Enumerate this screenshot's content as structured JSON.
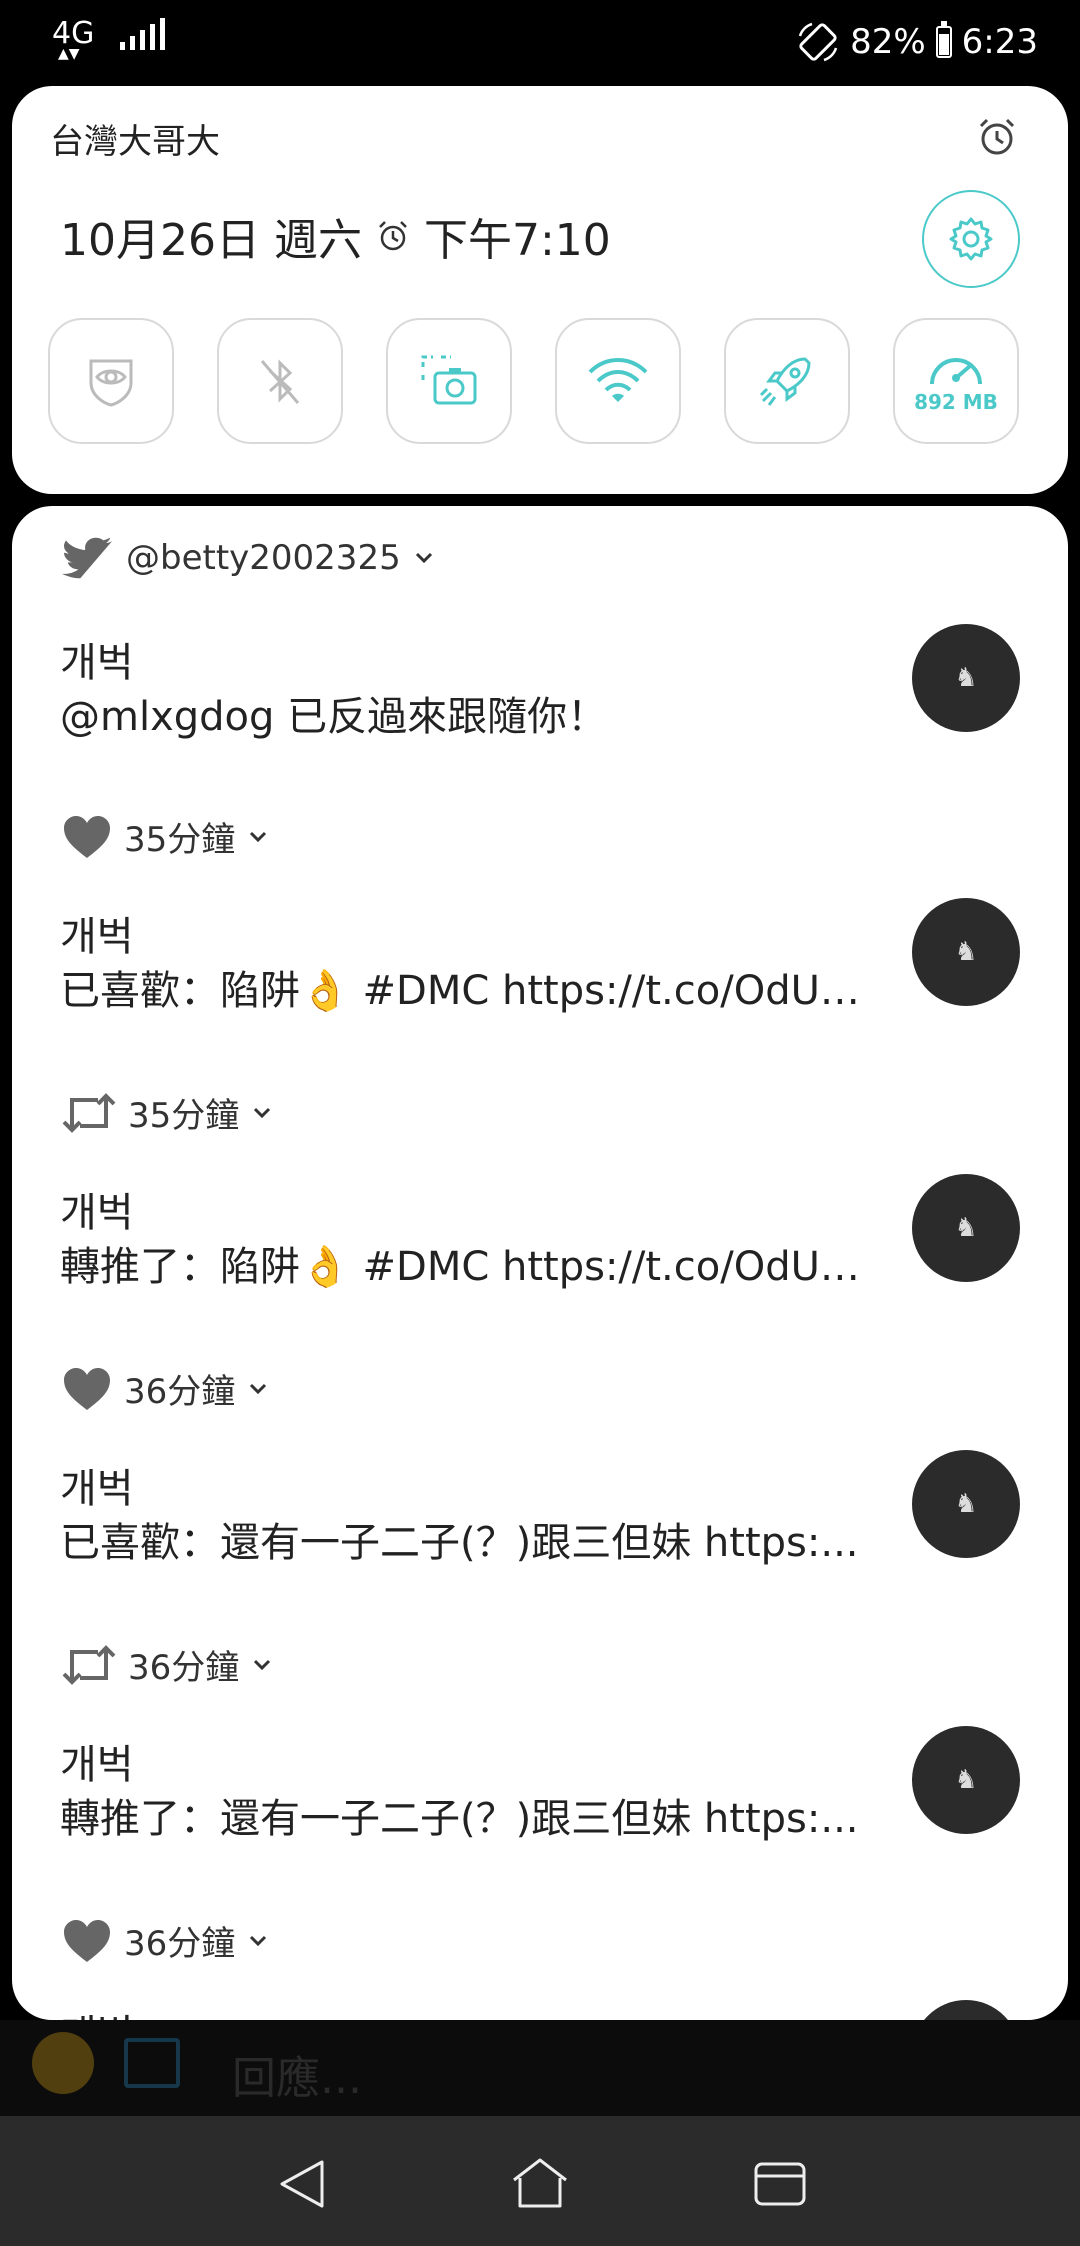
{
  "status_bar": {
    "network": "4G",
    "battery_percent": "82%",
    "time": "6:23",
    "battery_level": 0.82
  },
  "quick_settings": {
    "carrier": "台灣大哥大",
    "date": "10月26日 週六",
    "alarm_time": "下午7:10",
    "tiles": [
      {
        "icon": "eye-shield-icon"
      },
      {
        "icon": "bluetooth-off-icon"
      },
      {
        "icon": "screenshot-icon"
      },
      {
        "icon": "wifi-icon"
      },
      {
        "icon": "rocket-icon"
      },
      {
        "icon": "speedometer-icon",
        "label": "892 MB"
      }
    ],
    "accent_color": "#4bc9c9"
  },
  "notification": {
    "account": "@betty2002325",
    "items": [
      {
        "type": "follow",
        "name": "개벅",
        "message": "@mlxgdog 已反過來跟隨你！"
      },
      {
        "type": "like",
        "time": "35分鐘",
        "name": "개벅",
        "message": "已喜歡：陷阱👌 #DMC https://t.co/OdU2i..."
      },
      {
        "type": "retweet",
        "time": "35分鐘",
        "name": "개벅",
        "message": "轉推了：陷阱👌 #DMC https://t.co/OdU2i..."
      },
      {
        "type": "like",
        "time": "36分鐘",
        "name": "개벅",
        "message": "已喜歡：還有一子二子(？)跟三但妹 https:..."
      },
      {
        "type": "retweet",
        "time": "36分鐘",
        "name": "개벅",
        "message": "轉推了：還有一子二子(？)跟三但妹 https:..."
      },
      {
        "type": "like",
        "time": "36分鐘",
        "name": "개벅",
        "message": ""
      }
    ]
  },
  "reply_bar": {
    "placeholder": "回應..."
  }
}
